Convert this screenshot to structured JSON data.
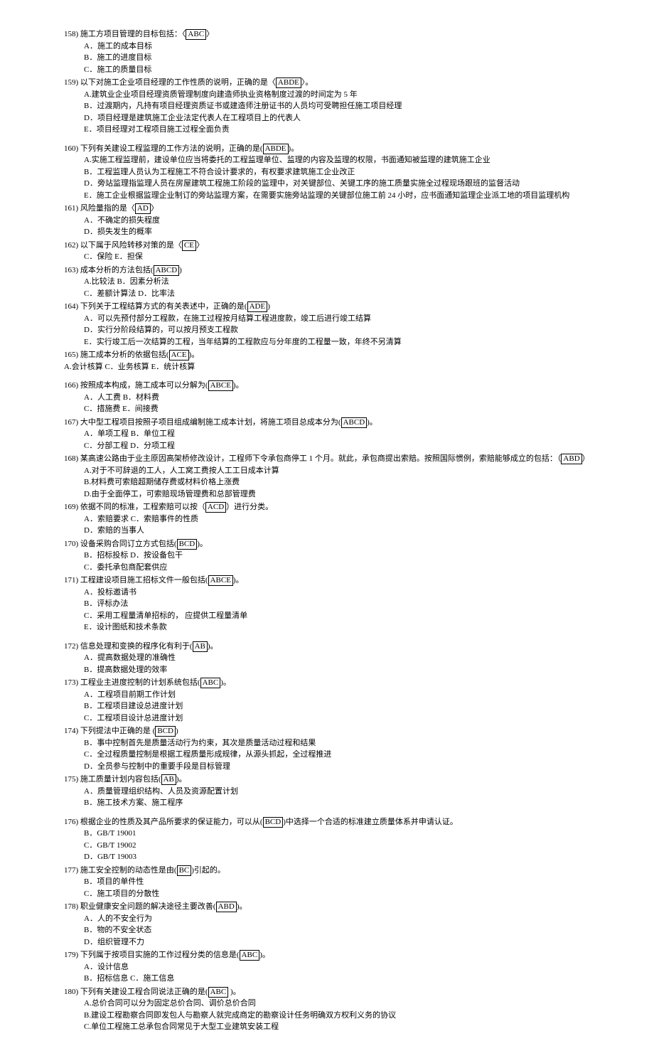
{
  "questions": [
    {
      "num": "158)",
      "stem_pre": "施工方项目管理的目标包括：〈",
      "ans": "ABC",
      "stem_post": "〉",
      "options": [
        "A．施工的成本目标",
        "B．施工的进度目标",
        "C．施工的质量目标"
      ]
    },
    {
      "num": "159)",
      "stem_pre": "以下对施工企业项目经理的工作性质的说明，正确的是〈",
      "ans": "ABDE",
      "stem_post": "〉。",
      "options": [
        "A.建筑业企业项目经理资质管理制度向建造师执业资格制度过渡的时间定为 5 年",
        "B．过渡期内，凡持有项目经理资质证书或建造师注册证书的人员均可受聘担任施工项目经理",
        "D．项目经理是建筑施工企业法定代表人在工程项目上的代表人",
        "E．项目经理对工程项目施工过程全面负责"
      ],
      "spacer_after": true
    },
    {
      "num": "160)",
      "stem_pre": "下列有关建设工程监理的工作方法的说明，正确的是(",
      "ans": "ABDE",
      "stem_post": ")。",
      "options": [
        "A.实施工程监理前，建设单位应当将委托的工程监理单位、监理的内容及监理的权限，书面通知被监理的建筑施工企业",
        "B．工程监理人员认为工程施工不符合设计要求的，有权要求建筑施工企业改正",
        "D．旁站监理指监理人员在房屋建筑工程施工阶段的监理中，对关键部位、关键工序的施工质量实施全过程现场跟班的监督活动",
        "E．施工企业根据监理企业制订的旁站监理方案，在需要实施旁站监理的关键部位施工前 24 小时，应书面通知监理企业派工地的项目监理机构"
      ]
    },
    {
      "num": "161)",
      "stem_pre": "风险量指的是〈",
      "ans": "AD",
      "stem_post": "〉",
      "options": [
        "A．不确定的损失程度",
        "D．损失发生的概率"
      ]
    },
    {
      "num": "162)",
      "stem_pre": "以下属于风险转移对策的是〈",
      "ans": "CE",
      "stem_post": "〉",
      "inline_options": "C．保险    E．担保"
    },
    {
      "num": "163)",
      "stem_pre": "成本分析的方法包括(",
      "ans": "ABCD",
      "stem_post": ")",
      "options": [
        "A.比较法      B．因素分析法",
        "C．差额计算法    D．比率法"
      ]
    },
    {
      "num": "164)",
      "stem_pre": "下列关于工程结算方式的有关表述中，正确的是(",
      "ans": "ADE",
      "stem_post": ")",
      "options": [
        "A．可以先预付部分工程款，在施工过程按月结算工程进度款，竣工后进行竣工结算",
        "D．实行分阶段结算的，可以按月预支工程款",
        "E．实行竣工后一次结算的工程，当年结算的工程款应与分年度的工程量一致，年终不另清算"
      ]
    },
    {
      "num": "165)",
      "stem_pre": "施工成本分析的依据包括(",
      "ans": "ACE",
      "stem_post": ")。",
      "note": "A.会计核算    C．业务核算    E．统计核算",
      "spacer_after": true
    },
    {
      "num": "166)",
      "stem_pre": "按照成本构成，施工成本可以分解为(",
      "ans": "ABCE",
      "stem_post": ")。",
      "options": [
        "  A．人工费    B．材料费",
        "C．措施费    E．间接费"
      ]
    },
    {
      "num": "167)",
      "stem_pre": "大中型工程项目按照子项目组成编制施工成本计划，将施工项目总成本分为(",
      "ans": "ABCD",
      "stem_post": ")。",
      "options": [
        "A．单项工程    B．单位工程",
        "C．分部工程    D．分项工程"
      ]
    },
    {
      "num": "168)",
      "stem_pre": "某高速公路由于业主原因高架桥修改设计，工程师下令承包商停工 1 个月。就此，承包商提出索赔。按照国际惯例，索赔能够成立的包括：（",
      "ans": "ABD",
      "stem_post": "）",
      "options": [
        "A.对于不可辞退的工人，人工窝工费按人工工日成本计算",
        "B.材料费可索赔超期储存费或材料价格上涨费",
        "D.由于全面停工，可索赔现场管理费和总部管理费"
      ]
    },
    {
      "num": "169)",
      "stem_pre": "依据不同的标准，工程索赔可以按（",
      "ans": "ACD",
      "stem_post": "）进行分类。",
      "options": [
        "A．索赔要求    C．索赔事件的性质",
        "D．索赔的当事人"
      ]
    },
    {
      "num": "170)",
      "stem_pre": "设备采购合同订立方式包括(",
      "ans": "BCD",
      "stem_post": ")。",
      "options": [
        "B．招标投标    D．按设备包干",
        "C．委托承包商配套供应"
      ]
    },
    {
      "num": "171)",
      "stem_pre": "工程建设项目施工招标文件一般包括(",
      "ans": "ABCE",
      "stem_post": ")。",
      "options": [
        "A．投标邀请书",
        "B．评标办法",
        "C．采用工程量清单招标的，  应提供工程量清单",
        "E．设计图纸和技术条款"
      ],
      "spacer_after": true
    },
    {
      "num": "172)",
      "stem_pre": "信息处理和变换的程序化有利于(",
      "ans": "AB",
      "stem_post": ")。",
      "options": [
        "A．提高数据处理的准确性",
        "B．提高数据处理的效率"
      ]
    },
    {
      "num": "173)",
      "stem_pre": "工程业主进度控制的计划系统包括(",
      "ans": "ABC",
      "stem_post": ")。",
      "options": [
        "A．工程项目前期工作计划",
        "B．工程项目建设总进度计划",
        "C．工程项目设计总进度计划"
      ]
    },
    {
      "num": "174)",
      "stem_pre": "下列提法中正确的是 (",
      "ans": "BCD",
      "stem_post": ")",
      "options": [
        "B．事中控制首先是质量活动行为约束，其次是质量活动过程和结果",
        "C．全过程质量控制是根据工程质量形成规律，从源头抓起，全过程推进",
        "D．全员参与控制中的重要手段是目标管理"
      ]
    },
    {
      "num": "175)",
      "stem_pre": "施工质量计划内容包括(",
      "ans": "AB",
      "stem_post": ")。",
      "options": [
        "A．质量管理组织结构、人员及资源配置计划",
        "B．施工技术方案、施工程序"
      ],
      "spacer_after": true
    },
    {
      "num": "176)",
      "stem_pre": "根据企业的性质及其产品所要求的保证能力，可以从(",
      "ans": "BCD",
      "stem_post": ")中选择一个合适的标准建立质量体系并申请认证。",
      "options": [
        "B．GB/T 19001",
        "C．GB/T 19002",
        "D．GB/T 19003"
      ]
    },
    {
      "num": "177)",
      "stem_pre": "施工安全控制的动态性是由(",
      "ans": "BC",
      "stem_post": ")引起的。",
      "options": [
        "B．项目的单件性",
        "C．施工项目的分散性"
      ]
    },
    {
      "num": "178)",
      "stem_pre": "职业健康安全问题的解决途径主要改善(",
      "ans": "ABD",
      "stem_post": ")。",
      "options": [
        "A．人的不安全行为",
        "B．物的不安全状态",
        "D．组织管理不力"
      ]
    },
    {
      "num": "179)",
      "stem_pre": "下列属于按项目实施的工作过程分类的信息是(",
      "ans": "ABC",
      "stem_post": ")。",
      "options": [
        "A．设计信息",
        "B．招标信息    C．施工信息"
      ]
    },
    {
      "num": "180)",
      "stem_pre": "下列有关建设工程合同说法正确的是(",
      "ans": "ABC",
      "stem_post": "   )。",
      "options": [
        "A.总价合同可以分为固定总价合同、调价总价合同",
        "B.建设工程勘察合同即发包人与勘察人就完成商定的勘察设计任务明确双方权利义务的协议",
        "C.单位工程施工总承包合同常见于大型工业建筑安装工程"
      ]
    }
  ]
}
